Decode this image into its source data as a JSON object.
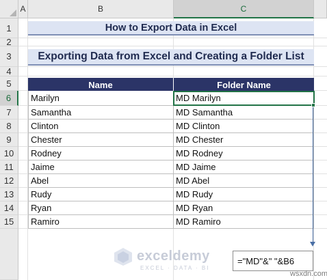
{
  "columns": {
    "a": "A",
    "b": "B",
    "c": "C"
  },
  "rows": [
    "1",
    "2",
    "3",
    "4",
    "5",
    "6",
    "7",
    "8",
    "9",
    "10",
    "11",
    "12",
    "13",
    "14",
    "15"
  ],
  "title": "How to Export Data in Excel",
  "subtitle": "Exporting Data from Excel and Creating a Folder List",
  "table": {
    "headers": [
      "Name",
      "Folder Name"
    ],
    "rows": [
      [
        "Marilyn",
        "MD Marilyn"
      ],
      [
        "Samantha",
        "MD Samantha"
      ],
      [
        "Clinton",
        "MD Clinton"
      ],
      [
        "Chester",
        "MD Chester"
      ],
      [
        "Rodney",
        "MD Rodney"
      ],
      [
        "Jaime",
        "MD Jaime"
      ],
      [
        "Abel",
        "MD Abel"
      ],
      [
        "Rudy",
        "MD Rudy"
      ],
      [
        "Ryan",
        "MD Ryan"
      ],
      [
        "Ramiro",
        "MD Ramiro"
      ]
    ]
  },
  "formula": "=\"MD\"&\" \"&B6",
  "watermark": {
    "name": "exceldemy",
    "tagline": "EXCEL · DATA · BI"
  },
  "source": "wsxdn.com",
  "colors": {
    "header_fill": "#2b3467",
    "title_fill": "#dde4f3",
    "selection": "#217346",
    "arrow": "#4a6fa5"
  },
  "icons": {
    "watermark_logo": "exceldemy-logo-icon",
    "corner": "select-all-triangle-icon"
  }
}
